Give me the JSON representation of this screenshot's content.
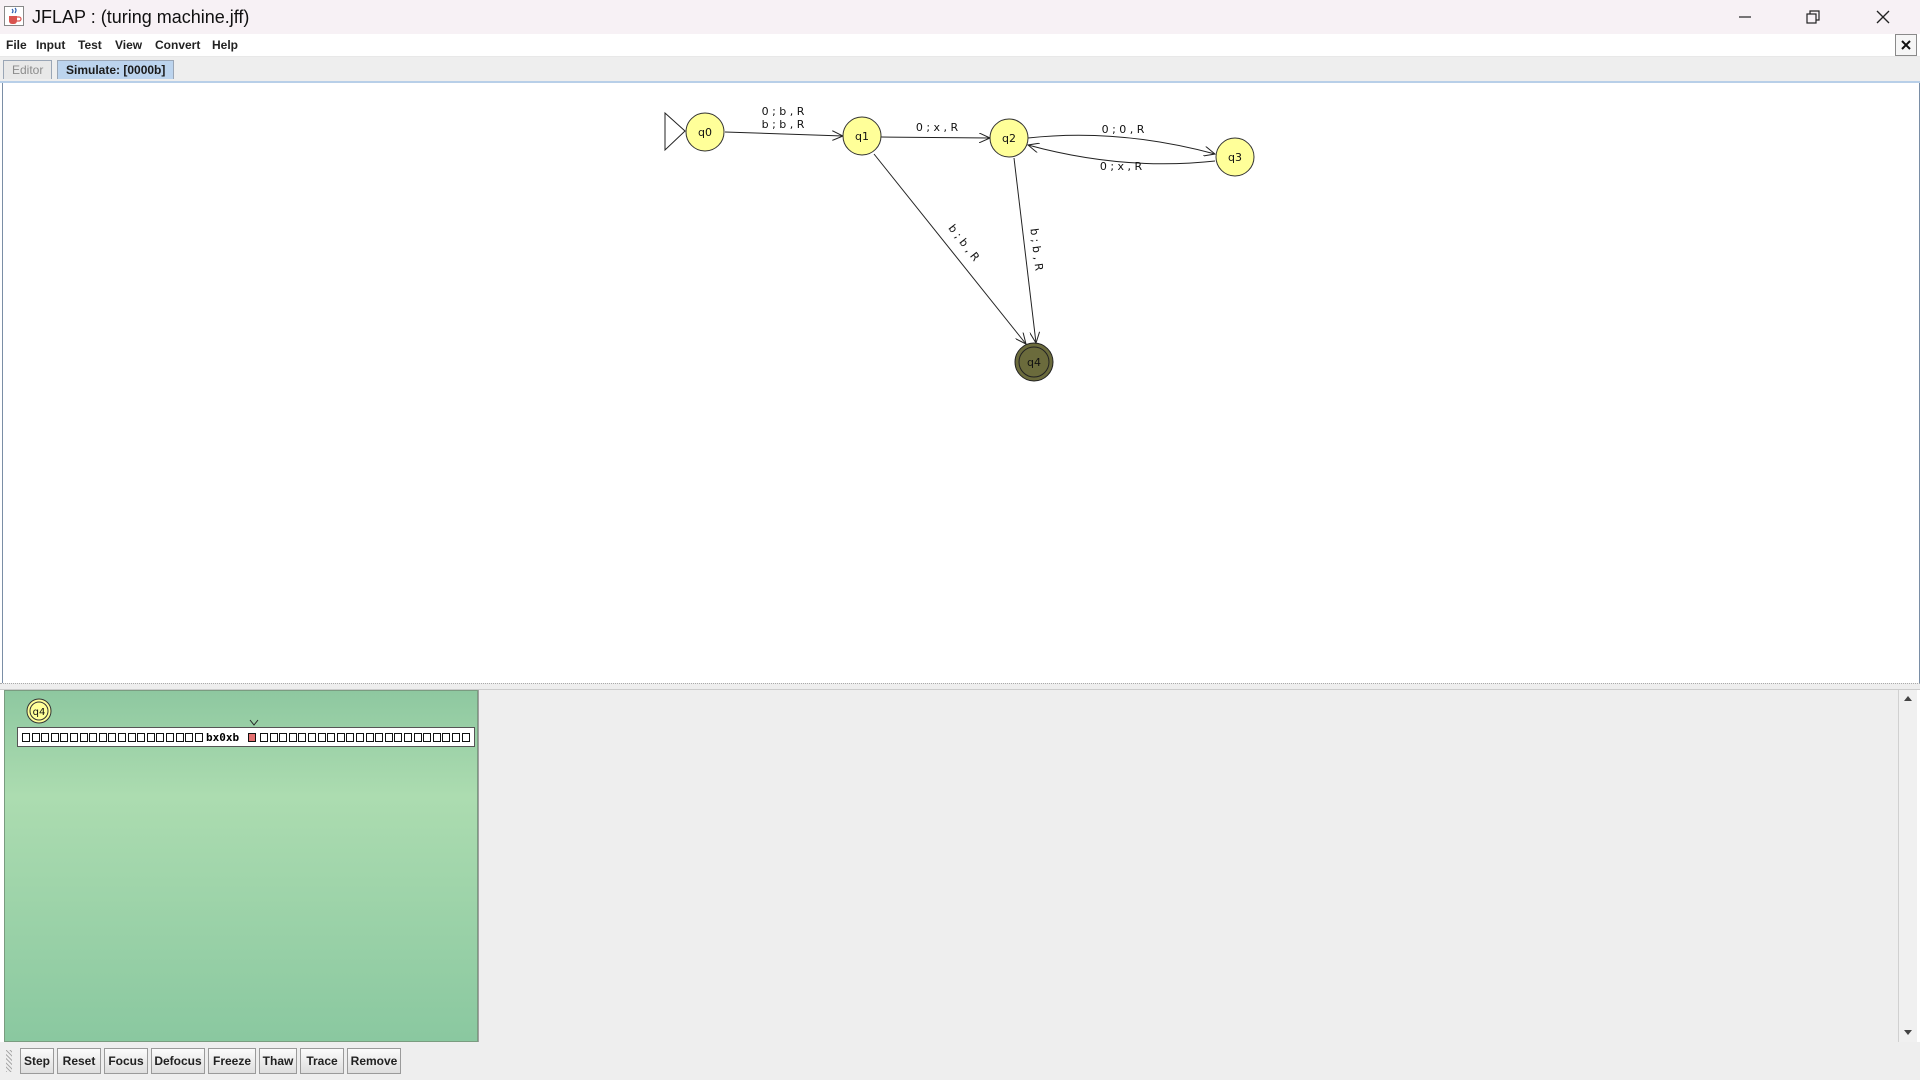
{
  "window": {
    "title": "JFLAP : (turing machine.jff)"
  },
  "menu": [
    "File",
    "Input",
    "Test",
    "View",
    "Convert",
    "Help"
  ],
  "tabs": {
    "editor": "Editor",
    "simulate": "Simulate: [0000b]"
  },
  "automaton": {
    "states": [
      "q0",
      "q1",
      "q2",
      "q3",
      "q4"
    ],
    "initial_state": "q0",
    "final_state": "q4",
    "transitions": [
      {
        "from": "q0",
        "to": "q1",
        "labels": [
          "0 ; b , R",
          "b ; b , R"
        ]
      },
      {
        "from": "q1",
        "to": "q2",
        "labels": [
          "0 ; x , R"
        ]
      },
      {
        "from": "q2",
        "to": "q3",
        "labels": [
          "0 ; 0 , R"
        ]
      },
      {
        "from": "q3",
        "to": "q2",
        "labels": [
          "0 ; x , R"
        ]
      },
      {
        "from": "q1",
        "to": "q4",
        "labels": [
          "b ; b , R"
        ]
      },
      {
        "from": "q2",
        "to": "q4",
        "labels": [
          "b ; b , R"
        ]
      }
    ]
  },
  "simulation": {
    "current_state": "q4",
    "tape_content": "bx0xb"
  },
  "toolbar": [
    "Step",
    "Reset",
    "Focus",
    "Defocus",
    "Freeze",
    "Thaw",
    "Trace",
    "Remove"
  ],
  "colors": {
    "state_fill": "#ffff99",
    "accepting_state_fill": "#6b6b3c",
    "head_cell": "#e47070",
    "config_bg": "#a6d8ae"
  }
}
